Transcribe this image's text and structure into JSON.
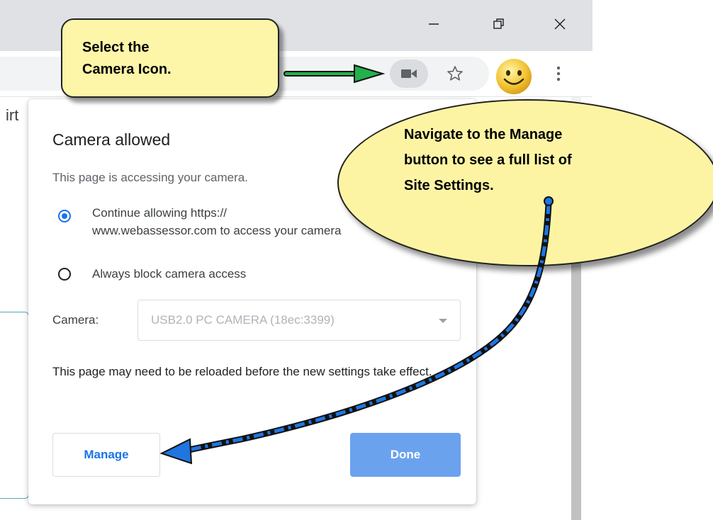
{
  "window": {
    "minimize_icon": "minimize-icon",
    "maximize_icon": "restore-icon",
    "close_icon": "close-icon"
  },
  "toolbar": {
    "camera_icon": "video-camera-icon",
    "star_icon": "star-icon",
    "profile_icon": "smiley-avatar-icon",
    "menu_icon": "kebab-menu-icon"
  },
  "page": {
    "fragment_text": "irt"
  },
  "popup": {
    "title": "Camera allowed",
    "subtitle": "This page is accessing your camera.",
    "options": [
      {
        "label": "Continue allowing https://\nwww.webassessor.com to access your camera",
        "selected": true
      },
      {
        "label": "Always block camera access",
        "selected": false
      }
    ],
    "camera_label": "Camera:",
    "camera_select": {
      "value": "USB2.0 PC CAMERA (18ec:3399)"
    },
    "note": "This page may need to be reloaded before the new settings take effect.",
    "manage_button": "Manage",
    "done_button": "Done"
  },
  "annotations": {
    "callout_top": "Select the\nCamera Icon.",
    "callout_oval": "Navigate to the Manage\nbutton to see a full list of\nSite Settings.",
    "colors": {
      "callout_fill": "#fdf5a8",
      "green_arrow": "#22b14c",
      "blue_arrow": "#0a64d8",
      "accent": "#1a73e8",
      "done_fill": "#6ba2ee"
    }
  }
}
